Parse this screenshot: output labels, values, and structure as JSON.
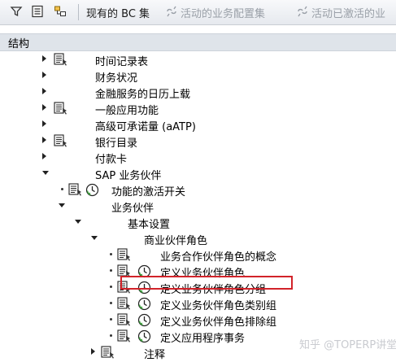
{
  "toolbar": {
    "bc_set_label": "现有的 BC 集",
    "activities_in_bc_config_label": "活动的业务配置集",
    "activated_business_label": "活动已激活的业"
  },
  "header": {
    "title": "结构"
  },
  "tree": [
    {
      "label": "时间记录表"
    },
    {
      "label": "财务状况"
    },
    {
      "label": "金融服务的日历上载"
    },
    {
      "label": "一般应用功能"
    },
    {
      "label": "高级可承诺量 (aATP)"
    },
    {
      "label": "银行目录"
    },
    {
      "label": "付款卡"
    },
    {
      "label": "SAP 业务伙伴"
    },
    {
      "label": "功能的激活开关"
    },
    {
      "label": "业务伙伴"
    },
    {
      "label": "基本设置"
    },
    {
      "label": "商业伙伴角色"
    },
    {
      "label": "业务合作伙伴角色的概念"
    },
    {
      "label": "定义业务伙伴角色"
    },
    {
      "label": "定义业务伙伴角色分组"
    },
    {
      "label": "定义业务伙伴角色类别组"
    },
    {
      "label": "定义业务伙伴角色排除组"
    },
    {
      "label": "定义应用程序事务"
    },
    {
      "label": "注释"
    }
  ],
  "watermark": "知乎 @TOPERP讲堂"
}
